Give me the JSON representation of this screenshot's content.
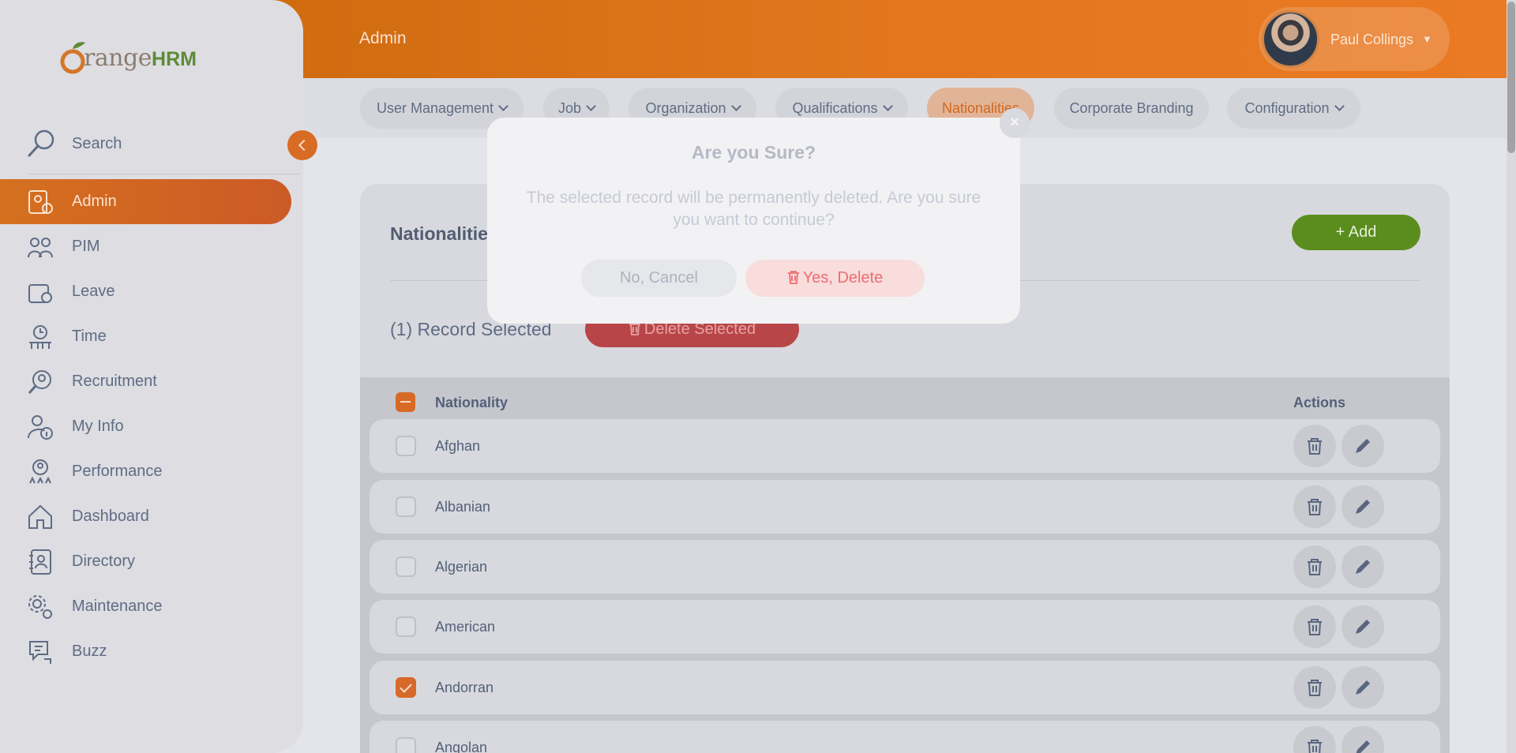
{
  "header": {
    "module_title": "Admin",
    "user_name": "Paul Collings"
  },
  "logo": {
    "text_orange": "range",
    "text_hrm": "HRM",
    "brand_colors": [
      "#e67e22",
      "#6aa336"
    ]
  },
  "sidebar": {
    "search_label": "Search",
    "items": [
      {
        "label": "Admin",
        "icon": "admin-icon",
        "active": true
      },
      {
        "label": "PIM",
        "icon": "pim-icon"
      },
      {
        "label": "Leave",
        "icon": "leave-icon"
      },
      {
        "label": "Time",
        "icon": "time-icon"
      },
      {
        "label": "Recruitment",
        "icon": "recruitment-icon"
      },
      {
        "label": "My Info",
        "icon": "my-info-icon"
      },
      {
        "label": "Performance",
        "icon": "performance-icon"
      },
      {
        "label": "Dashboard",
        "icon": "dashboard-icon"
      },
      {
        "label": "Directory",
        "icon": "directory-icon"
      },
      {
        "label": "Maintenance",
        "icon": "maintenance-icon"
      },
      {
        "label": "Buzz",
        "icon": "buzz-icon"
      }
    ]
  },
  "topnav": {
    "items": [
      {
        "label": "User Management",
        "dropdown": true
      },
      {
        "label": "Job",
        "dropdown": true
      },
      {
        "label": "Organization",
        "dropdown": true
      },
      {
        "label": "Qualifications",
        "dropdown": true
      },
      {
        "label": "Nationalities",
        "dropdown": false,
        "active": true
      },
      {
        "label": "Corporate Branding",
        "dropdown": false
      },
      {
        "label": "Configuration",
        "dropdown": true
      }
    ]
  },
  "main": {
    "title": "Nationalities",
    "add_label": "+ Add",
    "record_count": "(1) Record Selected",
    "delete_selected_label": "Delete Selected",
    "table": {
      "columns": [
        "Nationality",
        "Actions"
      ],
      "rows": [
        {
          "name": "Afghan",
          "checked": false
        },
        {
          "name": "Albanian",
          "checked": false
        },
        {
          "name": "Algerian",
          "checked": false
        },
        {
          "name": "American",
          "checked": false
        },
        {
          "name": "Andorran",
          "checked": true
        },
        {
          "name": "Angolan",
          "checked": false
        }
      ]
    }
  },
  "modal": {
    "title": "Are you Sure?",
    "message": "The selected record will be permanently deleted. Are you sure you want to continue?",
    "cancel_label": "No, Cancel",
    "confirm_label": "Yes, Delete",
    "close_label": "×"
  },
  "colors": {
    "accent": "#e67e22",
    "add_green": "#76bc21",
    "danger": "#eb0910"
  }
}
